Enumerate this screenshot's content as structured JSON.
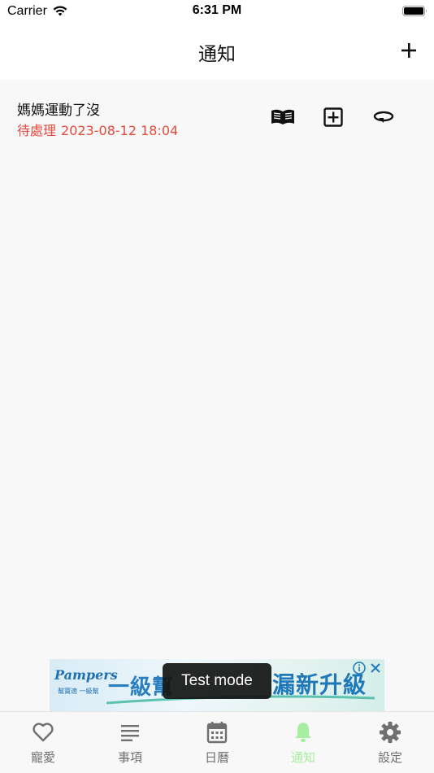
{
  "status_bar": {
    "carrier": "Carrier",
    "time": "6:31 PM"
  },
  "nav": {
    "title": "通知",
    "add_icon": "plus-icon"
  },
  "notifications": [
    {
      "title": "媽媽運動了沒",
      "status": "待處理",
      "datetime": "2023-08-12 18:04",
      "actions": [
        "book-icon",
        "plus-square-icon",
        "repeat-icon"
      ]
    }
  ],
  "ad": {
    "brand": "Pampers",
    "brand_sub": "幫寶適 一級幫",
    "headline_left": "一級幫",
    "headline_right": "漏新升級",
    "test_mode": "Test mode"
  },
  "tabs": [
    {
      "label": "寵愛",
      "icon": "heart-icon",
      "active": false
    },
    {
      "label": "事項",
      "icon": "list-icon",
      "active": false
    },
    {
      "label": "日曆",
      "icon": "calendar-icon",
      "active": false
    },
    {
      "label": "通知",
      "icon": "bell-icon",
      "active": true
    },
    {
      "label": "設定",
      "icon": "gear-icon",
      "active": false
    }
  ],
  "colors": {
    "accent_active_tab": "#a6eea0",
    "pending_red": "#e24b3b",
    "inactive_tab": "#6f6f6f",
    "background": "#f8f8f8"
  }
}
